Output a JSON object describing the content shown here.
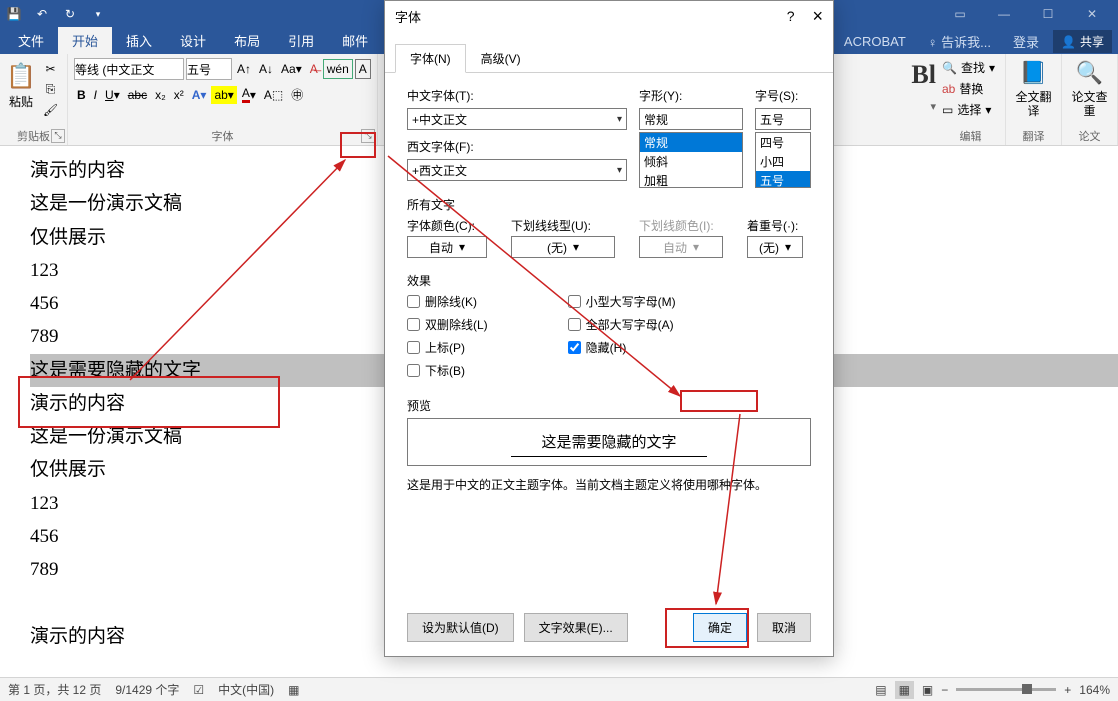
{
  "titlebar": {
    "qat": [
      "save",
      "undo",
      "redo"
    ]
  },
  "ribbonTabs": {
    "file": "文件",
    "home": "开始",
    "insert": "插入",
    "design": "设计",
    "layout": "布局",
    "references": "引用",
    "mailings": "邮件",
    "acrobat": "ACROBAT",
    "tellme": "告诉我...",
    "signin": "登录",
    "share": "共享"
  },
  "ribbon": {
    "clipboard": {
      "paste": "粘贴",
      "label": "剪贴板"
    },
    "font": {
      "family": "等线 (中文正文",
      "size": "五号",
      "label": "字体"
    },
    "partial": "Bl",
    "edit": {
      "find": "查找",
      "replace": "替换",
      "select": "选择",
      "label": "编辑"
    },
    "translate": {
      "btn": "全文翻译",
      "label": "翻译"
    },
    "check": {
      "btn": "论文查重",
      "label": "论文"
    }
  },
  "document": {
    "lines": [
      "演示的内容",
      "这是一份演示文稿",
      "仅供展示",
      "123",
      "456",
      "789",
      "这是需要隐藏的文字",
      "演示的内容",
      "这是一份演示文稿",
      "仅供展示",
      "123",
      "456",
      "789",
      "",
      "演示的内容"
    ],
    "selectedIndex": 6
  },
  "dialog": {
    "title": "字体",
    "help": "?",
    "close": "×",
    "tabs": {
      "font": "字体(N)",
      "advanced": "高级(V)"
    },
    "cnFontLabel": "中文字体(T):",
    "cnFont": "+中文正文",
    "enFontLabel": "西文字体(F):",
    "enFont": "+西文正文",
    "styleLabel": "字形(Y):",
    "styleValue": "常规",
    "styleOptions": [
      "常规",
      "倾斜",
      "加粗"
    ],
    "sizeLabel": "字号(S):",
    "sizeValue": "五号",
    "sizeOptions": [
      "四号",
      "小四",
      "五号"
    ],
    "allText": "所有文字",
    "fontColorLabel": "字体颜色(C):",
    "fontColor": "自动",
    "underlineLabel": "下划线线型(U):",
    "underline": "(无)",
    "underlineColorLabel": "下划线颜色(I):",
    "underlineColor": "自动",
    "emphasisLabel": "着重号(·):",
    "emphasis": "(无)",
    "effects": "效果",
    "fx": {
      "strike": "删除线(K)",
      "dblstrike": "双删除线(L)",
      "super": "上标(P)",
      "sub": "下标(B)",
      "smallcaps": "小型大写字母(M)",
      "allcaps": "全部大写字母(A)",
      "hidden": "隐藏(H)"
    },
    "preview": "预览",
    "previewText": "这是需要隐藏的文字",
    "previewNote": "这是用于中文的正文主题字体。当前文档主题定义将使用哪种字体。",
    "setDefault": "设为默认值(D)",
    "textEffects": "文字效果(E)...",
    "ok": "确定",
    "cancel": "取消"
  },
  "statusbar": {
    "page": "第 1 页，共 12 页",
    "words": "9/1429 个字",
    "lang": "中文(中国)",
    "zoom": "164%"
  }
}
